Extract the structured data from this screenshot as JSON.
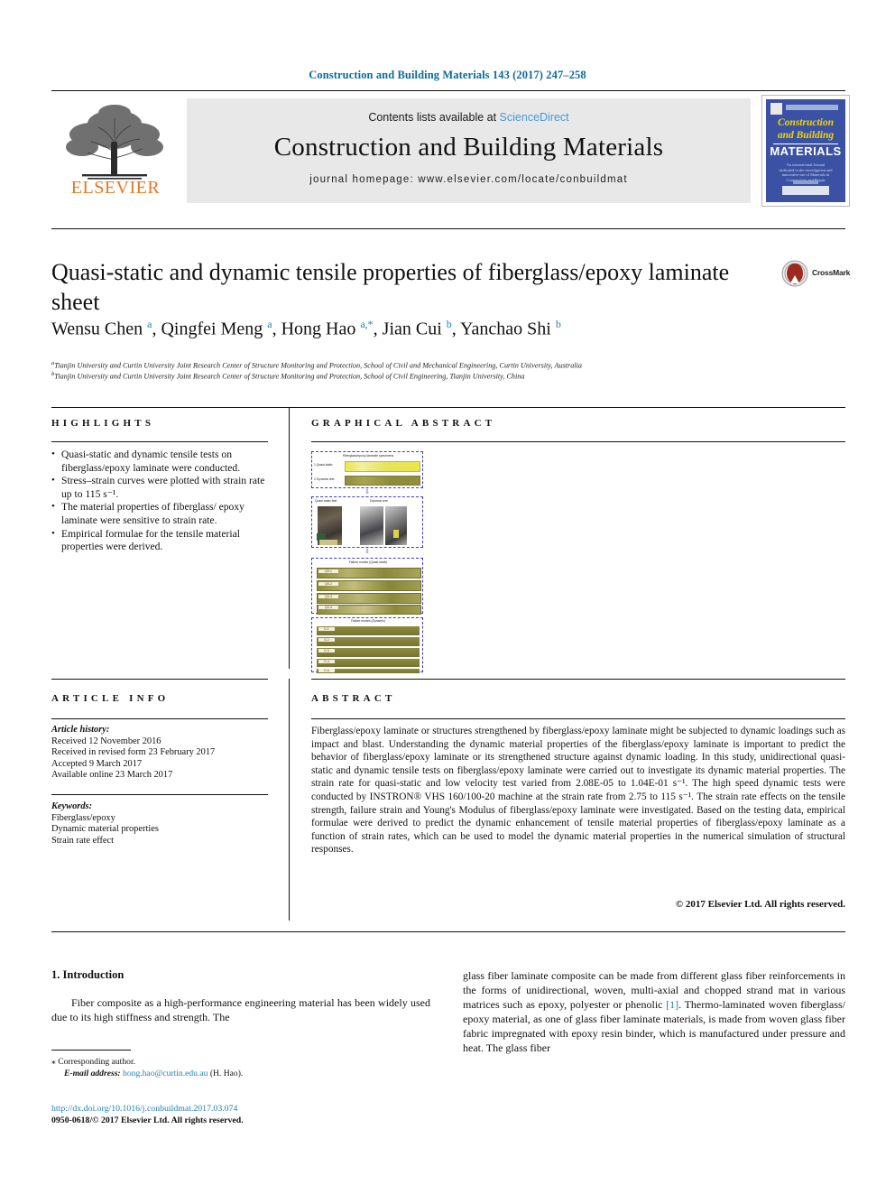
{
  "running_head": "Construction and Building Materials 143 (2017) 247–258",
  "masthead": {
    "contents_prefix": "Contents lists available at ",
    "sciencedirect": "ScienceDirect",
    "journal_title": "Construction and Building Materials",
    "homepage": "journal homepage: www.elsevier.com/locate/conbuildmat",
    "publisher": "ELSEVIER",
    "cover": {
      "line1": "Construction",
      "line2": "and Building",
      "line3": "MATERIALS",
      "blurb": "An international Journal dedicated to the investigation and innovative use of Materials in Construction and Repair"
    }
  },
  "article": {
    "title": "Quasi-static and dynamic tensile properties of fiberglass/epoxy laminate sheet",
    "crossmark_label": "CrossMark",
    "authors_html": "Wensu Chen <sup>a</sup>, Qingfei Meng <sup>a</sup>, Hong Hao <sup>a,*</sup>, Jian Cui <sup>b</sup>, Yanchao Shi <sup>b</sup>",
    "affiliation_a": "Tianjin University and Curtin University Joint Research Center of Structure Monitoring and Protection, School of Civil and Mechanical Engineering, Curtin University, Australia",
    "affiliation_b": "Tianjin University and Curtin University Joint Research Center of Structure Monitoring and Protection, School of Civil Engineering, Tianjin University, China"
  },
  "highlights": {
    "heading": "HIGHLIGHTS",
    "items": [
      "Quasi-static and dynamic tensile tests on fiberglass/epoxy laminate were conducted.",
      "Stress–strain curves were plotted with strain rate up to 115 s⁻¹.",
      "The material properties of fiberglass/ epoxy laminate were sensitive to strain rate.",
      "Empirical formulae for the tensile material properties were derived."
    ]
  },
  "graphical_abstract": {
    "heading": "GRAPHICAL ABSTRACT",
    "panels": [
      {
        "caption": "Fiberglass/epoxy laminate specimens",
        "rows": [
          "1.Quasi-static",
          "2.Dynamic test"
        ]
      },
      {
        "caption_left": "Quasi-static test",
        "caption_right": "Dynamic test"
      },
      {
        "caption": "Failure modes (Quasi-static)",
        "labels": [
          "QS-1",
          "QS-2",
          "QS-3",
          "QS-4"
        ],
        "values": [
          "5-1",
          "1-4",
          "3-4",
          "1-3.1#"
        ]
      },
      {
        "caption": "Failure modes (Dynamic)",
        "labels": [
          "D-1",
          "D-2",
          "D-3",
          "D-4",
          "D-5"
        ]
      }
    ]
  },
  "article_info": {
    "heading": "ARTICLE INFO",
    "history_label": "Article history:",
    "history": [
      "Received 12 November 2016",
      "Received in revised form 23 February 2017",
      "Accepted 9 March 2017",
      "Available online 23 March 2017"
    ],
    "keywords_label": "Keywords:",
    "keywords": [
      "Fiberglass/epoxy",
      "Dynamic material properties",
      "Strain rate effect"
    ]
  },
  "abstract": {
    "heading": "ABSTRACT",
    "text": "Fiberglass/epoxy laminate or structures strengthened by fiberglass/epoxy laminate might be subjected to dynamic loadings such as impact and blast. Understanding the dynamic material properties of the fiberglass/epoxy laminate is important to predict the behavior of fiberglass/epoxy laminate or its strengthened structure against dynamic loading. In this study, unidirectional quasi-static and dynamic tensile tests on fiberglass/epoxy laminate were carried out to investigate its dynamic material properties. The strain rate for quasi-static and low velocity test varied from 2.08E-05 to 1.04E-01 s⁻¹. The high speed dynamic tests were conducted by INSTRON® VHS 160/100-20 machine at the strain rate from 2.75 to 115 s⁻¹. The strain rate effects on the tensile strength, failure strain and Young's Modulus of fiberglass/epoxy laminate were investigated. Based on the testing data, empirical formulae were derived to predict the dynamic enhancement of tensile material properties of fiberglass/epoxy laminate as a function of strain rates, which can be used to model the dynamic material properties in the numerical simulation of structural responses.",
    "copyright": "© 2017 Elsevier Ltd. All rights reserved."
  },
  "body": {
    "section_heading": "1. Introduction",
    "left_paragraph": "Fiber composite as a high-performance engineering material has been widely used due to its high stiffness and strength. The",
    "right_paragraph_pre": "glass fiber laminate composite can be made from different glass fiber reinforcements in the forms of unidirectional, woven, multi-axial and chopped strand mat in various matrices such as epoxy, polyester or phenolic ",
    "right_reference": "[1]",
    "right_paragraph_post": ". Thermo-laminated woven fiberglass/ epoxy material, as one of glass fiber laminate materials, is made from woven glass fiber fabric impregnated with epoxy resin binder, which is manufactured under pressure and heat. The glass fiber"
  },
  "footer": {
    "corresponding_marker": "⁎",
    "corresponding_text": "Corresponding author.",
    "email_label": "E-mail address:",
    "email": "hong.hao@curtin.edu.au",
    "email_suffix": "(H. Hao).",
    "doi": "http://dx.doi.org/10.1016/j.conbuildmat.2017.03.074",
    "issn_line": "0950-0618/© 2017 Elsevier Ltd. All rights reserved."
  },
  "colors": {
    "link": "#1f7fb5",
    "runhead": "#0b6a9b",
    "elsevier_orange": "#E87722",
    "cover_blue": "#3b52a4",
    "cover_yellow": "#f4d400",
    "ga_dashed": "#3a3ad0",
    "specimen_olive": "#8a8a3c",
    "specimen_yellow": "#e9e54a"
  }
}
